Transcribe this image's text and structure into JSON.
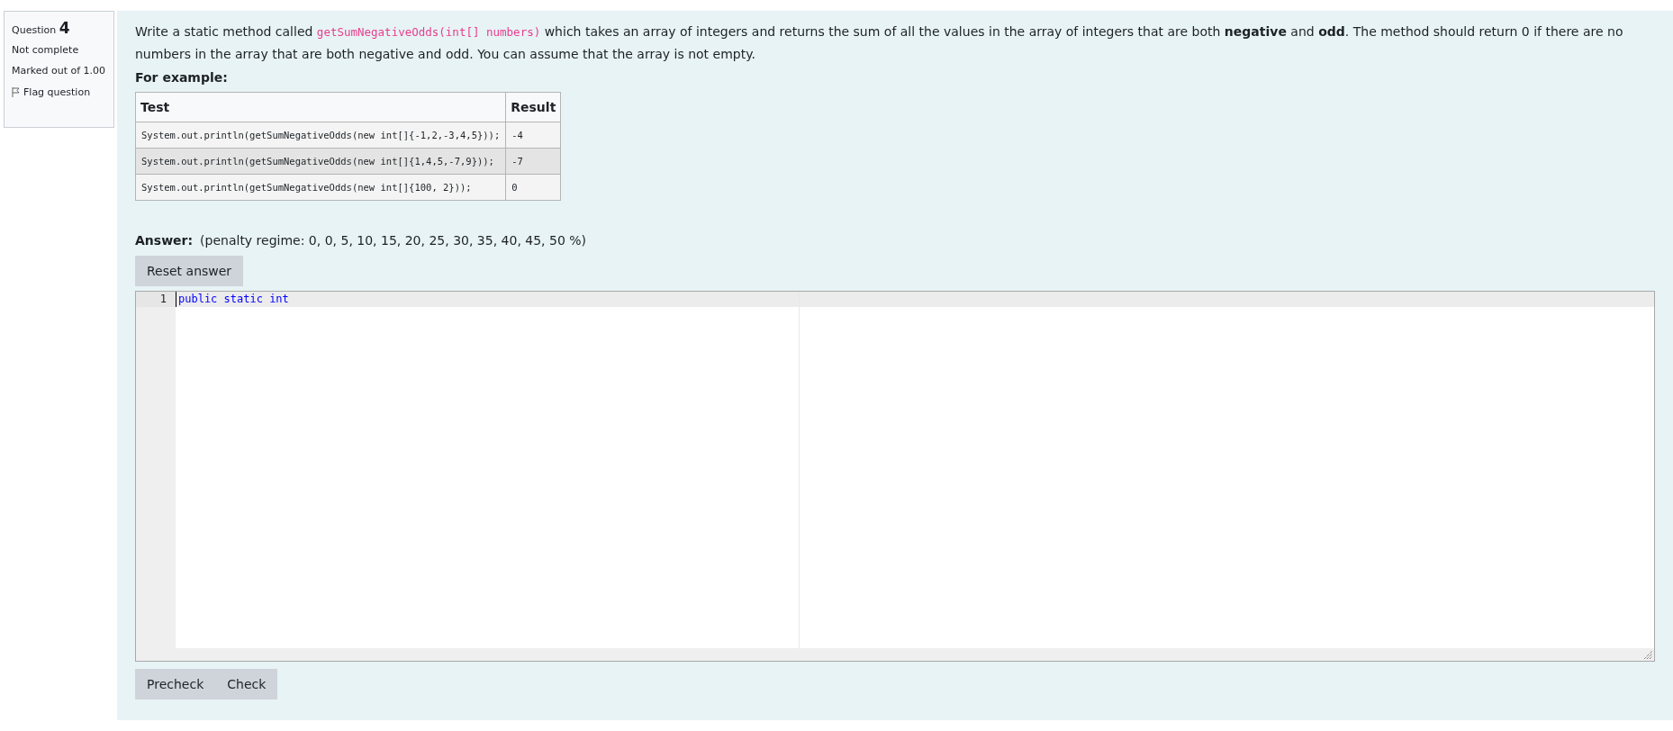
{
  "info": {
    "question_label": "Question",
    "question_number": "4",
    "status": "Not complete",
    "mark": "Marked out of 1.00",
    "flag": "Flag question"
  },
  "description": [
    {
      "kind": "text",
      "text": "Write a static method called "
    },
    {
      "kind": "code",
      "text": "getSumNegativeOdds(int[] numbers)"
    },
    {
      "kind": "text",
      "text": " which takes an array of integers and returns the sum of all the values in the array of integers that are both **negative** and **odd**. The method should return 0 if there are no numbers in the array that are both negative and odd. You can assume that the array is not empty."
    }
  ],
  "example_heading": "For example:",
  "table": {
    "columns": [
      "Test",
      "Result"
    ],
    "rows": [
      {
        "cells": [
          "System.out.println(getSumNegativeOdds(new int[]{-1,2,-3,4,5}));",
          "-4"
        ]
      },
      {
        "cells": [
          "System.out.println(getSumNegativeOdds(new int[]{1,4,5,-7,9}));",
          "-7"
        ]
      },
      {
        "cells": [
          "System.out.println(getSumNegativeOdds(new int[]{100, 2}));",
          "0"
        ]
      }
    ]
  },
  "answer_label": "Answer:",
  "penalty": "(penalty regime: 0, 0, 5, 10, 15, 20, 25, 30, 35, 40, 45, 50 %)",
  "reset_button": "Reset answer",
  "editor": {
    "lines": [
      {
        "number": "1",
        "text": "public static int",
        "current": true
      }
    ]
  },
  "buttons": [
    "Precheck",
    "Check"
  ]
}
